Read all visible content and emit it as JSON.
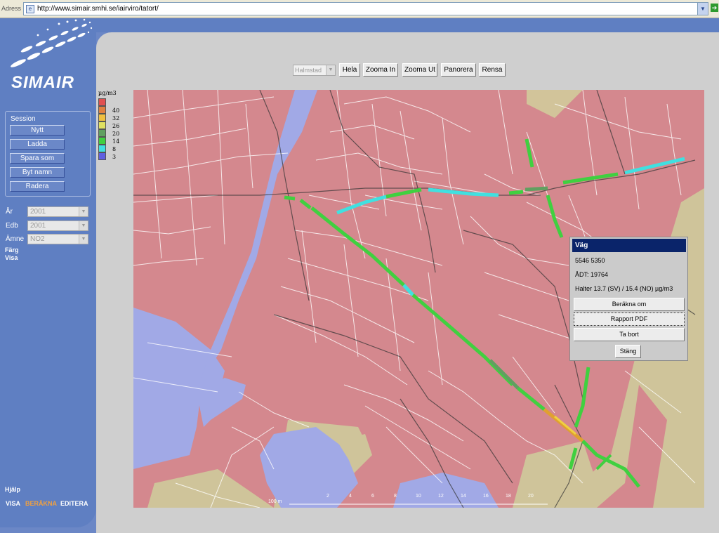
{
  "browser": {
    "address_label": "Adress",
    "url": "http://www.simair.smhi.se/iairviro/tatort/"
  },
  "sidebar": {
    "logo": "SIMAIR",
    "session": {
      "title": "Session",
      "buttons": [
        "Nytt",
        "Ladda",
        "Spara som",
        "Byt namn",
        "Radera"
      ]
    },
    "fields": [
      {
        "label": "År",
        "value": "2001"
      },
      {
        "label": "Edb",
        "value": "2001"
      },
      {
        "label": "Ämne",
        "value": "NO2"
      }
    ],
    "links": {
      "farg": "Färg",
      "visa": "Visa",
      "hjalp": "Hjälp",
      "bottom_visa": "VISA",
      "bottom_berakna": "BERÄKNA",
      "bottom_editera": "EDITERA"
    }
  },
  "toolbar": {
    "city_select": "Halmstad",
    "buttons": [
      "Hela",
      "Zooma In",
      "Zooma Ut",
      "Panorera",
      "Rensa"
    ]
  },
  "legend": {
    "unit": "µg/m3",
    "entries": [
      {
        "label": "",
        "color": "#e05050"
      },
      {
        "label": "40",
        "color": "#e08040"
      },
      {
        "label": "32",
        "color": "#f0c040"
      },
      {
        "label": "26",
        "color": "#e0e060"
      },
      {
        "label": "20",
        "color": "#60a060"
      },
      {
        "label": "14",
        "color": "#40d040"
      },
      {
        "label": "8",
        "color": "#40e0e0"
      },
      {
        "label": "3",
        "color": "#6060e0"
      }
    ]
  },
  "map": {
    "scale_label": "100 m",
    "scale_ticks": [
      "2",
      "4",
      "6",
      "8",
      "10",
      "12",
      "14",
      "16",
      "18",
      "20"
    ]
  },
  "popup": {
    "title": "Väg",
    "coords": "5546 5350",
    "adt": "ÅDT: 19764",
    "halter": "Halter  13.7 (SV) / 15.4 (NO) µg/m3",
    "buttons": {
      "berakna": "Beräkna om",
      "rapport": "Rapport PDF",
      "ta_bort": "Ta bort",
      "stang": "Stäng"
    }
  }
}
